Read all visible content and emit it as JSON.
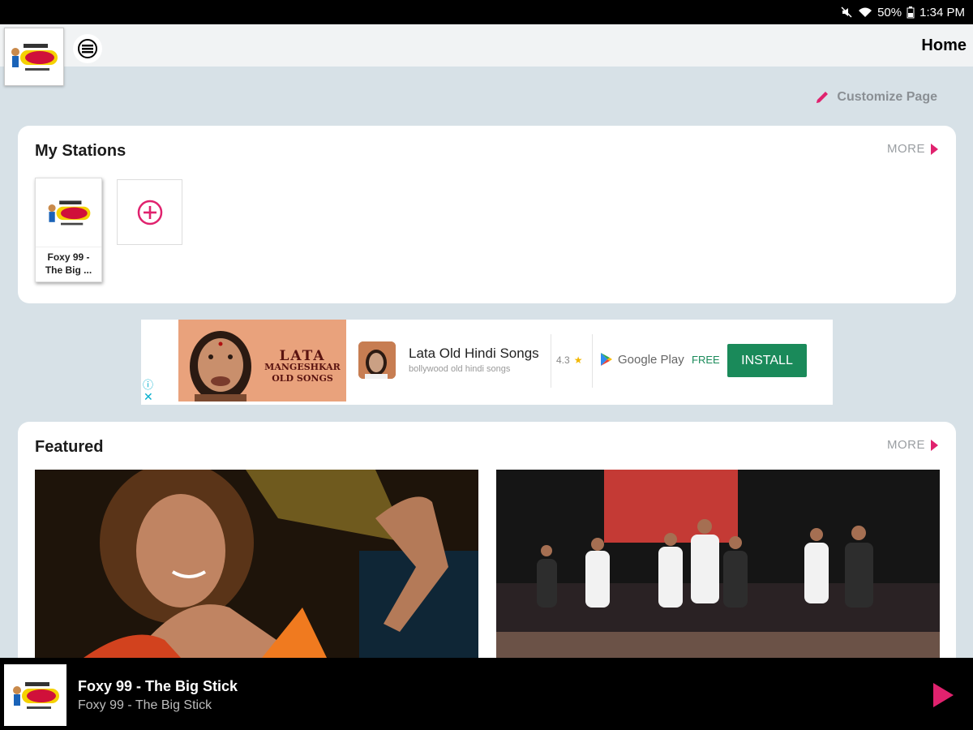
{
  "status_bar": {
    "battery": "50%",
    "time": "1:34 PM"
  },
  "app_bar": {
    "title": "Home"
  },
  "customize": {
    "label": "Customize Page"
  },
  "my_stations": {
    "title": "My Stations",
    "more_label": "MORE",
    "stations": [
      {
        "name": "Foxy 99 - The Big ..."
      }
    ]
  },
  "ad": {
    "image_text_line1": "LATA",
    "image_text_line2": "MANGESHKAR",
    "image_text_line3": "OLD SONGS",
    "app_title": "Lata Old Hindi Songs",
    "app_subtitle": "bollywood old hindi songs",
    "rating": "4.3",
    "store": "Google Play",
    "price": "FREE",
    "install_label": "INSTALL"
  },
  "featured": {
    "title": "Featured",
    "more_label": "MORE"
  },
  "player": {
    "title": "Foxy 99 - The Big Stick",
    "subtitle": "Foxy 99 - The Big Stick"
  },
  "colors": {
    "accent": "#e0226e",
    "install_green": "#1a8a5a",
    "background": "#d7e1e7"
  }
}
